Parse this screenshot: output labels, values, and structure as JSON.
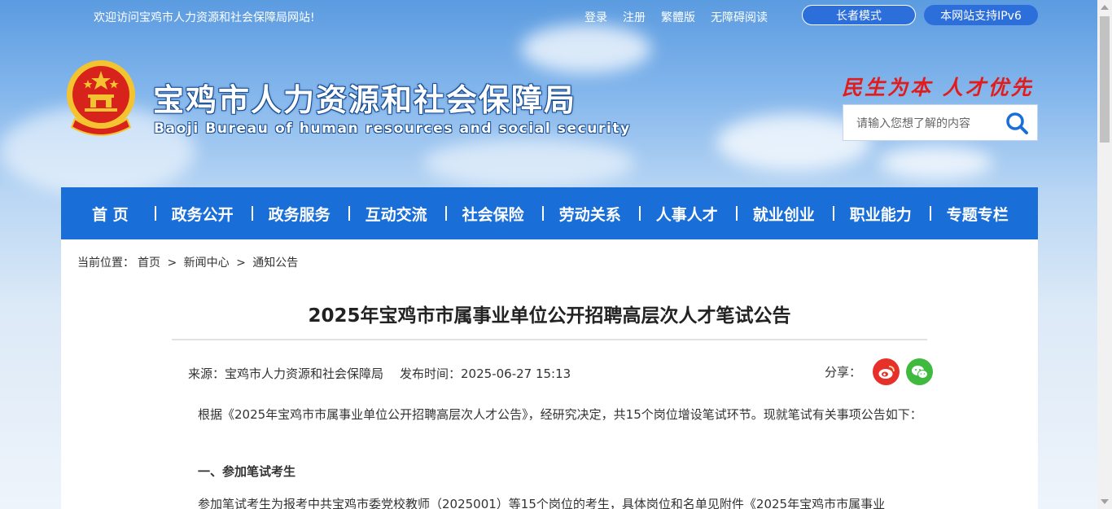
{
  "topbar": {
    "welcome": "欢迎访问宝鸡市人力资源和社会保障局网站!",
    "links": [
      "登录",
      "注册",
      "繁體版",
      "无障碍阅读"
    ],
    "elder_mode": "长者模式",
    "ipv6": "本网站支持IPv6"
  },
  "header": {
    "title": "宝鸡市人力资源和社会保障局",
    "subtitle": "Baoji Bureau of human resources and social security",
    "slogan": "民生为本 人才优先",
    "search_placeholder": "请输入您想了解的内容",
    "emblem_icon": "national-emblem-icon"
  },
  "nav": {
    "items": [
      "首 页",
      "政务公开",
      "政务服务",
      "互动交流",
      "社会保险",
      "劳动关系",
      "人事人才",
      "就业创业",
      "职业能力",
      "专题专栏"
    ]
  },
  "article": {
    "breadcrumb": [
      "当前位置：",
      "首页",
      ">",
      "新闻中心",
      ">",
      "通知公告"
    ],
    "title": "2025年宝鸡市市属事业单位公开招聘高层次人才笔试公告",
    "source": "来源：宝鸡市人力资源和社会保障局",
    "publish_time": "发布时间：2025-06-27 15:13",
    "share_label": "分享：",
    "paragraph1": "根据《2025年宝鸡市市属事业单位公开招聘高层次人才公告》，经研究决定，共15个岗位增设笔试环节。现就笔试有关事项公告如下：",
    "heading1": "一、参加笔试考生",
    "paragraph2": "参加笔试考生为报考中共宝鸡市委党校教师（2025001）等15个岗位的考生，具体岗位和名单见附件《2025年宝鸡市市属事业"
  },
  "colors": {
    "nav_bg": "#1a6ed8",
    "slogan": "#e21c1c",
    "weibo": "#e6312a",
    "wechat": "#3fba3e"
  }
}
